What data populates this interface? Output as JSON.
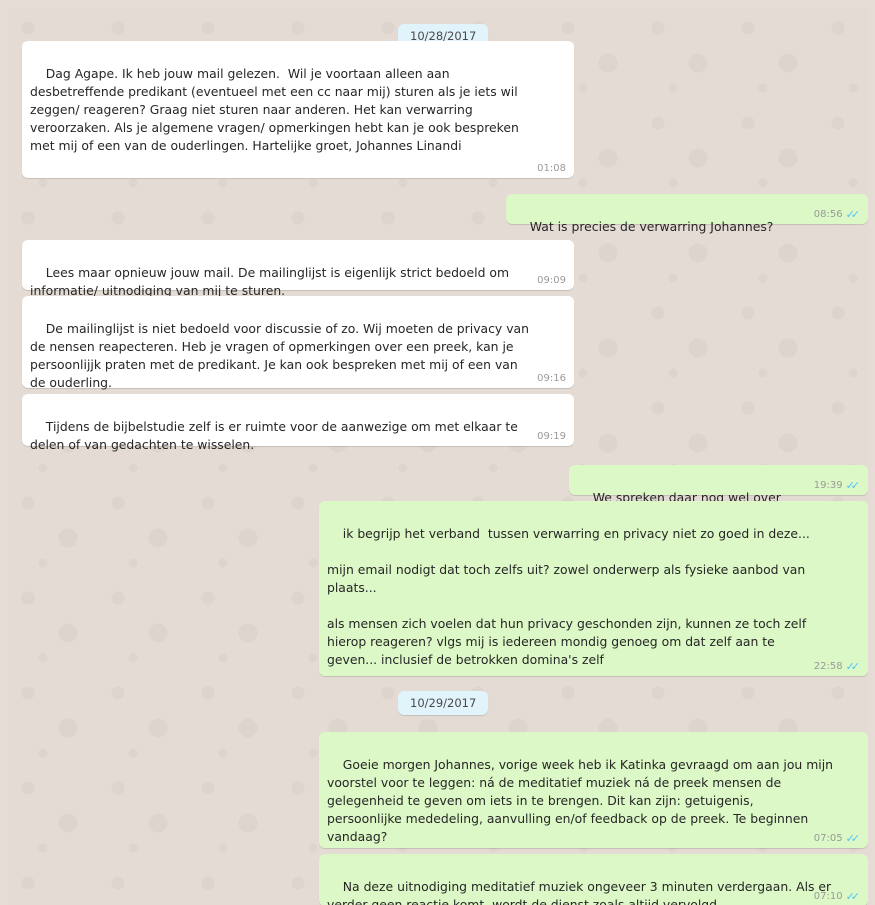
{
  "dates": [
    "10/28/2017",
    "10/29/2017"
  ],
  "messages": [
    {
      "dir": "in",
      "text": "Dag Agape. Ik heb jouw mail gelezen.  Wil je voortaan alleen aan\ndesbetreffende predikant (eventueel met een cc naar mij) sturen als je iets wil\nzeggen/ reageren? Graag niet sturen naar anderen. Het kan verwarring\nveroorzaken. Als je algemene vragen/ opmerkingen hebt kan je ook bespreken\nmet mij of een van de ouderlingen. Hartelijke groet, Johannes Linandi",
      "time": "01:08"
    },
    {
      "dir": "out",
      "text": "Wat is precies de verwarring Johannes?",
      "time": "08:56",
      "ticks": "✓✓"
    },
    {
      "dir": "in",
      "text": "Lees maar opnieuw jouw mail. De mailinglijst is eigenlijk strict bedoeld om\ninformatie/ uitnodiging van mij te sturen.",
      "time": "09:09"
    },
    {
      "dir": "in",
      "text": "De mailinglijst is niet bedoeld voor discussie of zo. Wij moeten de privacy van\nde nensen reapecteren. Heb je vragen of opmerkingen over een preek, kan je\npersoonlijjk praten met de predikant. Je kan ook bespreken met mij of een van\nde ouderling.",
      "time": "09:16"
    },
    {
      "dir": "in",
      "text": "Tijdens de bijbelstudie zelf is er ruimte voor de aanwezige om met elkaar te\ndelen of van gedachten te wisselen.",
      "time": "09:19"
    },
    {
      "dir": "out",
      "text": "We spreken daar nog wel over",
      "time": "19:39",
      "ticks": "✓✓"
    },
    {
      "dir": "out",
      "text": "ik begrijp het verband  tussen verwarring en privacy niet zo goed in deze...\n\nmijn email nodigt dat toch zelfs uit? zowel onderwerp als fysieke aanbod van\nplaats...\n\nals mensen zich voelen dat hun privacy geschonden zijn, kunnen ze toch zelf\nhierop reageren? vlgs mij is iedereen mondig genoeg om dat zelf aan te\ngeven... inclusief de betrokken domina's zelf",
      "time": "22:58",
      "ticks": "✓✓"
    },
    {
      "dir": "out",
      "text": "Goeie morgen Johannes, vorige week heb ik Katinka gevraagd om aan jou mijn\nvoorstel voor te leggen: ná de meditatief muziek ná de preek mensen de\ngelegenheid te geven om iets in te brengen. Dit kan zijn: getuigenis,\npersoonlijke mededeling, aanvulling en/of feedback op de preek. Te beginnen\nvandaag?",
      "time": "07:05",
      "ticks": "✓✓"
    },
    {
      "dir": "out",
      "text": "Na deze uitnodiging meditatief muziek ongeveer 3 minuten verdergaan. Als er\nverder geen reactie komt, wordt de dienst zoals altijd vervolgd",
      "time": "07:10",
      "ticks": "✓✓"
    }
  ]
}
